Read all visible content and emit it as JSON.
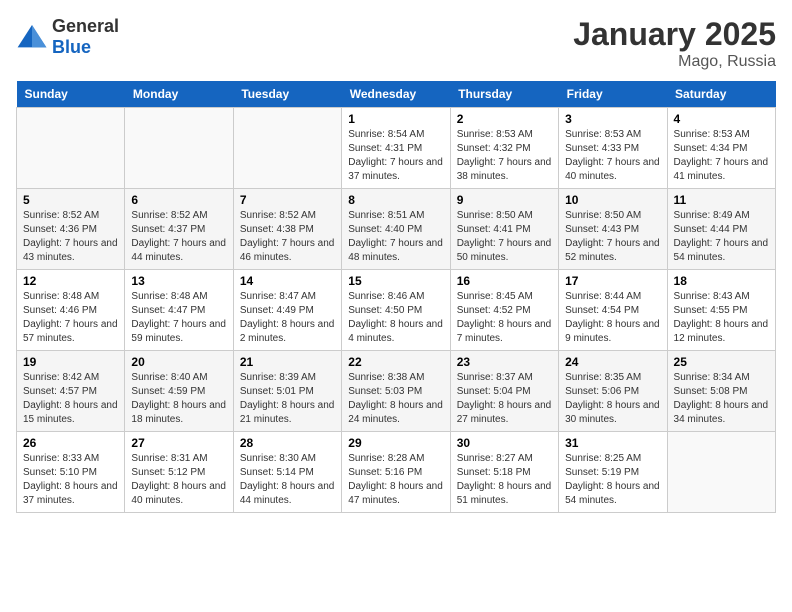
{
  "header": {
    "logo_general": "General",
    "logo_blue": "Blue",
    "month": "January 2025",
    "location": "Mago, Russia"
  },
  "weekdays": [
    "Sunday",
    "Monday",
    "Tuesday",
    "Wednesday",
    "Thursday",
    "Friday",
    "Saturday"
  ],
  "weeks": [
    [
      {
        "day": "",
        "sunrise": "",
        "sunset": "",
        "daylight": ""
      },
      {
        "day": "",
        "sunrise": "",
        "sunset": "",
        "daylight": ""
      },
      {
        "day": "",
        "sunrise": "",
        "sunset": "",
        "daylight": ""
      },
      {
        "day": "1",
        "sunrise": "Sunrise: 8:54 AM",
        "sunset": "Sunset: 4:31 PM",
        "daylight": "Daylight: 7 hours and 37 minutes."
      },
      {
        "day": "2",
        "sunrise": "Sunrise: 8:53 AM",
        "sunset": "Sunset: 4:32 PM",
        "daylight": "Daylight: 7 hours and 38 minutes."
      },
      {
        "day": "3",
        "sunrise": "Sunrise: 8:53 AM",
        "sunset": "Sunset: 4:33 PM",
        "daylight": "Daylight: 7 hours and 40 minutes."
      },
      {
        "day": "4",
        "sunrise": "Sunrise: 8:53 AM",
        "sunset": "Sunset: 4:34 PM",
        "daylight": "Daylight: 7 hours and 41 minutes."
      }
    ],
    [
      {
        "day": "5",
        "sunrise": "Sunrise: 8:52 AM",
        "sunset": "Sunset: 4:36 PM",
        "daylight": "Daylight: 7 hours and 43 minutes."
      },
      {
        "day": "6",
        "sunrise": "Sunrise: 8:52 AM",
        "sunset": "Sunset: 4:37 PM",
        "daylight": "Daylight: 7 hours and 44 minutes."
      },
      {
        "day": "7",
        "sunrise": "Sunrise: 8:52 AM",
        "sunset": "Sunset: 4:38 PM",
        "daylight": "Daylight: 7 hours and 46 minutes."
      },
      {
        "day": "8",
        "sunrise": "Sunrise: 8:51 AM",
        "sunset": "Sunset: 4:40 PM",
        "daylight": "Daylight: 7 hours and 48 minutes."
      },
      {
        "day": "9",
        "sunrise": "Sunrise: 8:50 AM",
        "sunset": "Sunset: 4:41 PM",
        "daylight": "Daylight: 7 hours and 50 minutes."
      },
      {
        "day": "10",
        "sunrise": "Sunrise: 8:50 AM",
        "sunset": "Sunset: 4:43 PM",
        "daylight": "Daylight: 7 hours and 52 minutes."
      },
      {
        "day": "11",
        "sunrise": "Sunrise: 8:49 AM",
        "sunset": "Sunset: 4:44 PM",
        "daylight": "Daylight: 7 hours and 54 minutes."
      }
    ],
    [
      {
        "day": "12",
        "sunrise": "Sunrise: 8:48 AM",
        "sunset": "Sunset: 4:46 PM",
        "daylight": "Daylight: 7 hours and 57 minutes."
      },
      {
        "day": "13",
        "sunrise": "Sunrise: 8:48 AM",
        "sunset": "Sunset: 4:47 PM",
        "daylight": "Daylight: 7 hours and 59 minutes."
      },
      {
        "day": "14",
        "sunrise": "Sunrise: 8:47 AM",
        "sunset": "Sunset: 4:49 PM",
        "daylight": "Daylight: 8 hours and 2 minutes."
      },
      {
        "day": "15",
        "sunrise": "Sunrise: 8:46 AM",
        "sunset": "Sunset: 4:50 PM",
        "daylight": "Daylight: 8 hours and 4 minutes."
      },
      {
        "day": "16",
        "sunrise": "Sunrise: 8:45 AM",
        "sunset": "Sunset: 4:52 PM",
        "daylight": "Daylight: 8 hours and 7 minutes."
      },
      {
        "day": "17",
        "sunrise": "Sunrise: 8:44 AM",
        "sunset": "Sunset: 4:54 PM",
        "daylight": "Daylight: 8 hours and 9 minutes."
      },
      {
        "day": "18",
        "sunrise": "Sunrise: 8:43 AM",
        "sunset": "Sunset: 4:55 PM",
        "daylight": "Daylight: 8 hours and 12 minutes."
      }
    ],
    [
      {
        "day": "19",
        "sunrise": "Sunrise: 8:42 AM",
        "sunset": "Sunset: 4:57 PM",
        "daylight": "Daylight: 8 hours and 15 minutes."
      },
      {
        "day": "20",
        "sunrise": "Sunrise: 8:40 AM",
        "sunset": "Sunset: 4:59 PM",
        "daylight": "Daylight: 8 hours and 18 minutes."
      },
      {
        "day": "21",
        "sunrise": "Sunrise: 8:39 AM",
        "sunset": "Sunset: 5:01 PM",
        "daylight": "Daylight: 8 hours and 21 minutes."
      },
      {
        "day": "22",
        "sunrise": "Sunrise: 8:38 AM",
        "sunset": "Sunset: 5:03 PM",
        "daylight": "Daylight: 8 hours and 24 minutes."
      },
      {
        "day": "23",
        "sunrise": "Sunrise: 8:37 AM",
        "sunset": "Sunset: 5:04 PM",
        "daylight": "Daylight: 8 hours and 27 minutes."
      },
      {
        "day": "24",
        "sunrise": "Sunrise: 8:35 AM",
        "sunset": "Sunset: 5:06 PM",
        "daylight": "Daylight: 8 hours and 30 minutes."
      },
      {
        "day": "25",
        "sunrise": "Sunrise: 8:34 AM",
        "sunset": "Sunset: 5:08 PM",
        "daylight": "Daylight: 8 hours and 34 minutes."
      }
    ],
    [
      {
        "day": "26",
        "sunrise": "Sunrise: 8:33 AM",
        "sunset": "Sunset: 5:10 PM",
        "daylight": "Daylight: 8 hours and 37 minutes."
      },
      {
        "day": "27",
        "sunrise": "Sunrise: 8:31 AM",
        "sunset": "Sunset: 5:12 PM",
        "daylight": "Daylight: 8 hours and 40 minutes."
      },
      {
        "day": "28",
        "sunrise": "Sunrise: 8:30 AM",
        "sunset": "Sunset: 5:14 PM",
        "daylight": "Daylight: 8 hours and 44 minutes."
      },
      {
        "day": "29",
        "sunrise": "Sunrise: 8:28 AM",
        "sunset": "Sunset: 5:16 PM",
        "daylight": "Daylight: 8 hours and 47 minutes."
      },
      {
        "day": "30",
        "sunrise": "Sunrise: 8:27 AM",
        "sunset": "Sunset: 5:18 PM",
        "daylight": "Daylight: 8 hours and 51 minutes."
      },
      {
        "day": "31",
        "sunrise": "Sunrise: 8:25 AM",
        "sunset": "Sunset: 5:19 PM",
        "daylight": "Daylight: 8 hours and 54 minutes."
      },
      {
        "day": "",
        "sunrise": "",
        "sunset": "",
        "daylight": ""
      }
    ]
  ]
}
